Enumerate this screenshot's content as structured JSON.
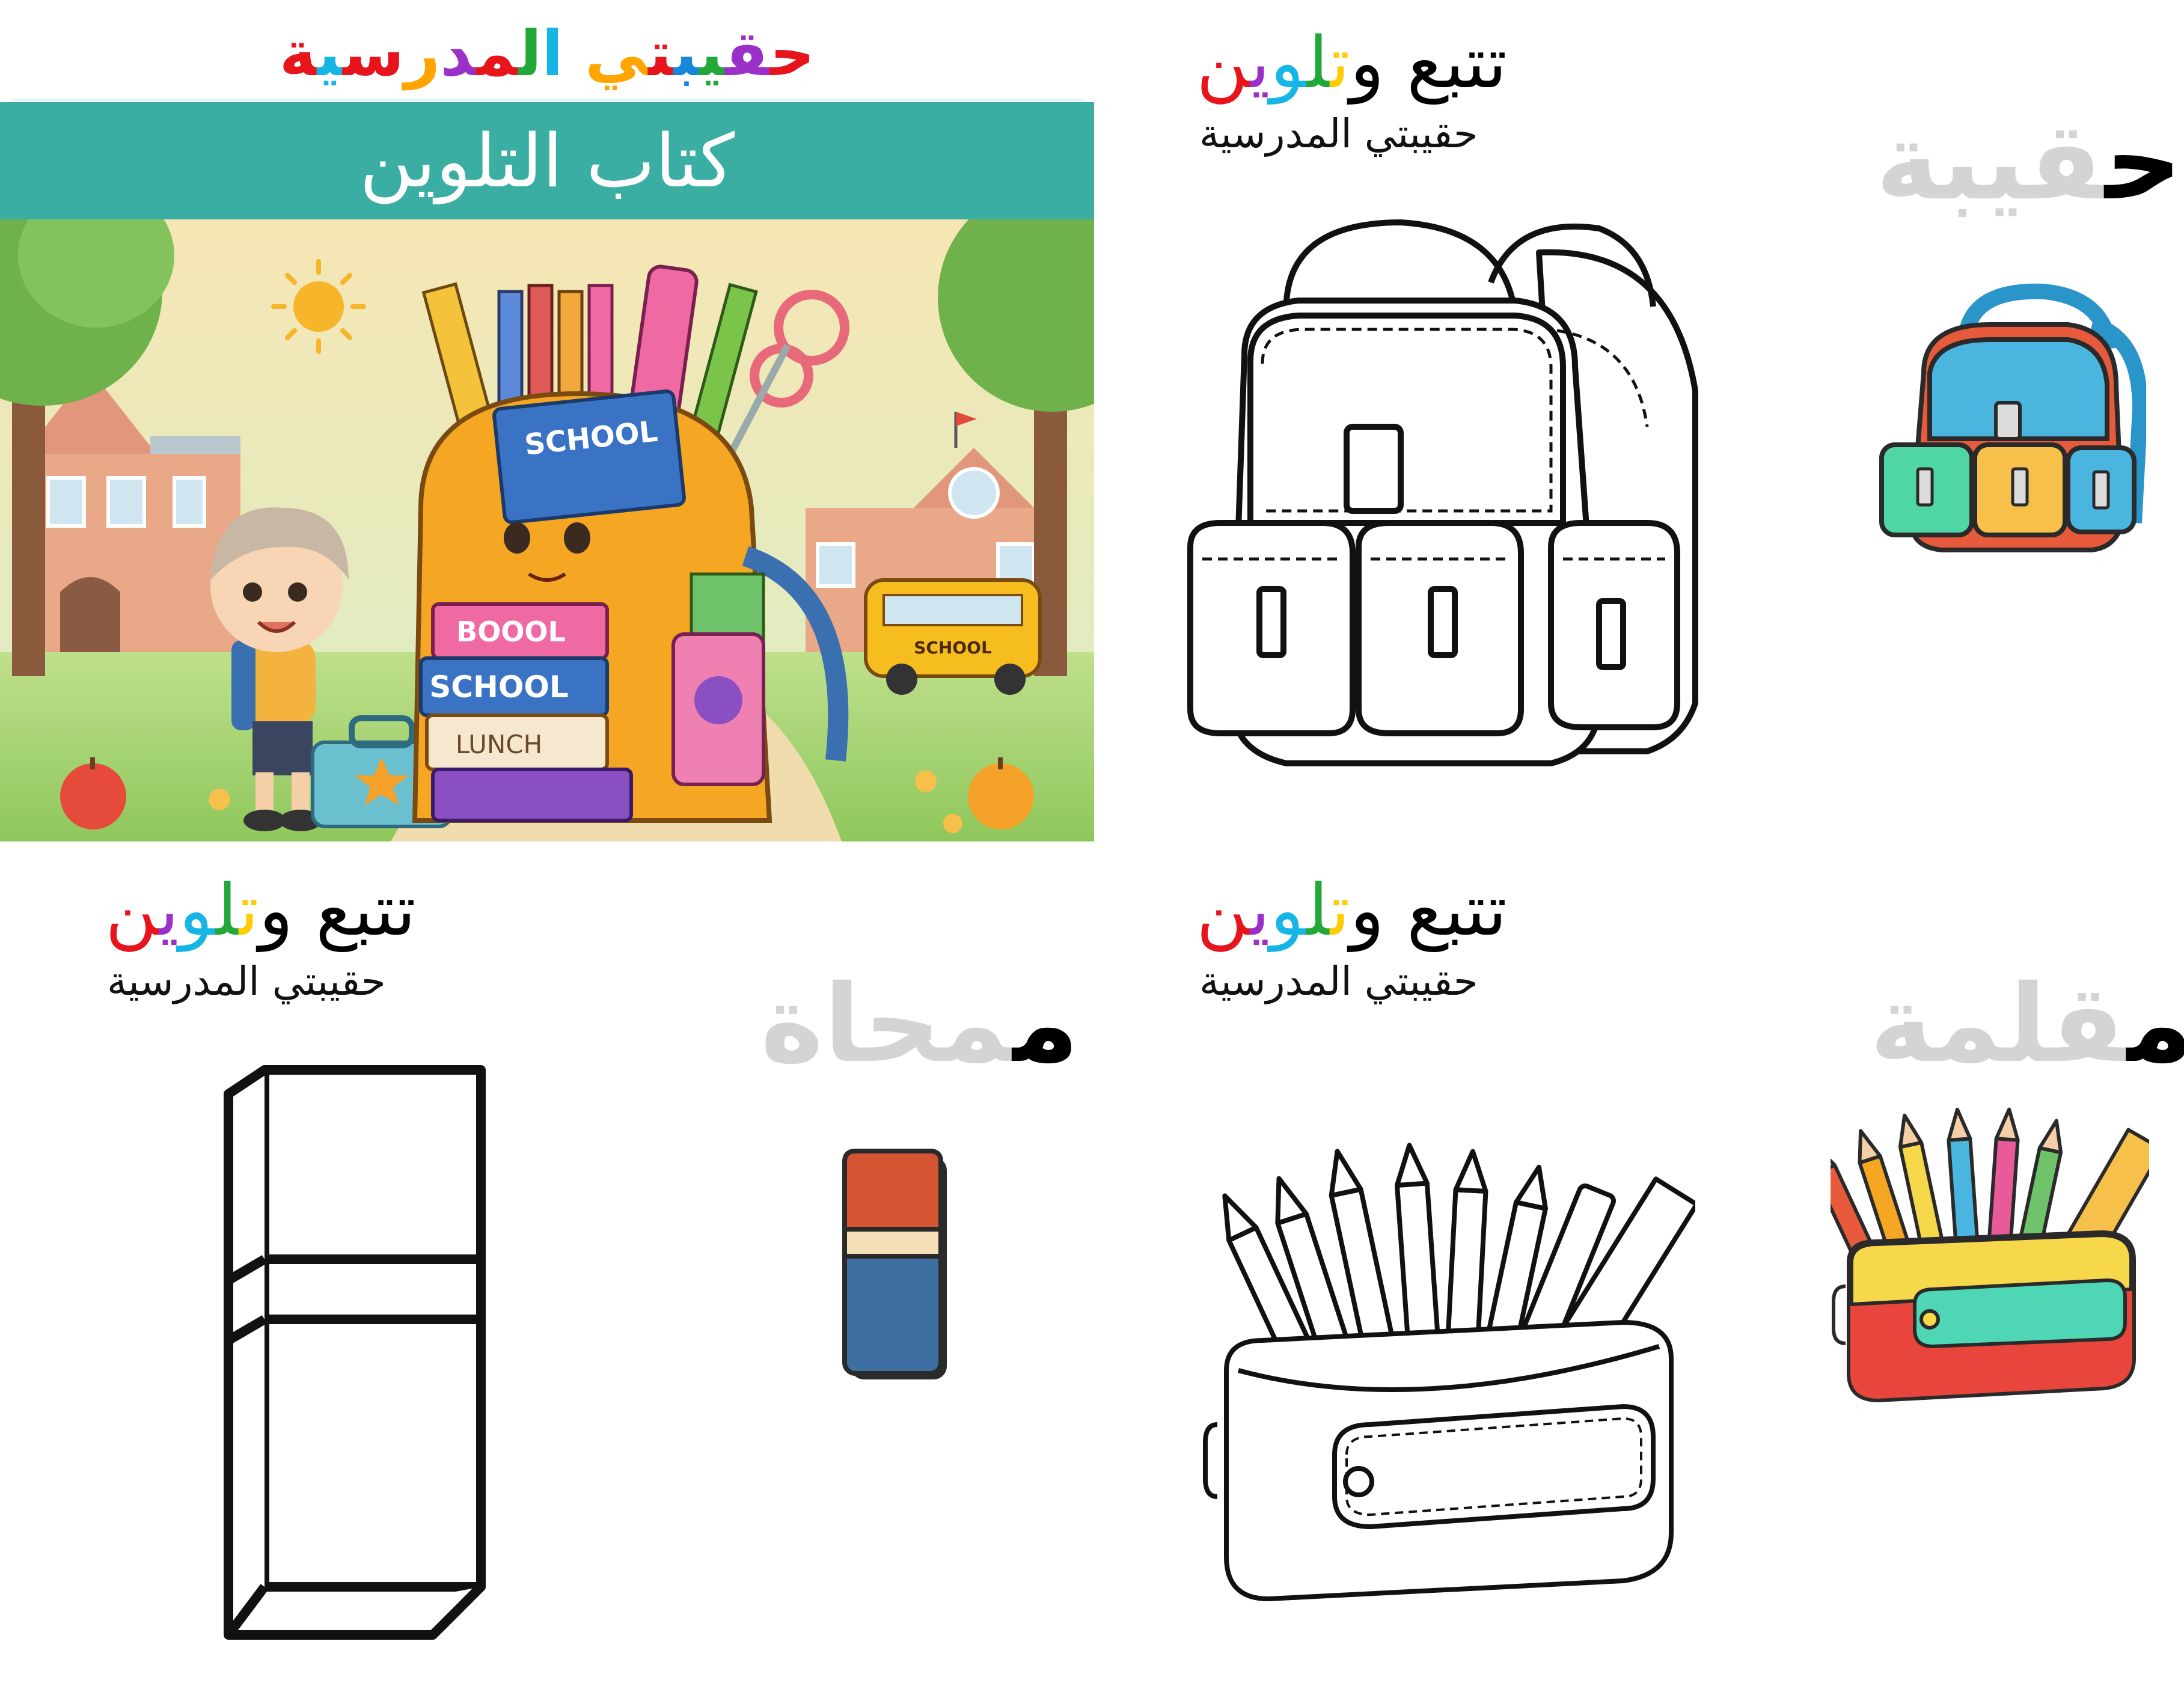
{
  "colors": {
    "teal_band": "#3baea3",
    "trace_gray": "#d4d4d4",
    "ink": "#000000"
  },
  "cover": {
    "title_letters": [
      {
        "char": "ح",
        "color": "#e8141c"
      },
      {
        "char": "ق",
        "color": "#9b30c9"
      },
      {
        "char": "ي",
        "color": "#22a839"
      },
      {
        "char": "ب",
        "color": "#1787d9"
      },
      {
        "char": "ت",
        "color": "#e8141c"
      },
      {
        "char": "ي",
        "color": "#ffa500"
      },
      {
        "char": " ",
        "color": "#000000"
      },
      {
        "char": "ا",
        "color": "#16b5e6"
      },
      {
        "char": "ل",
        "color": "#22a839"
      },
      {
        "char": "م",
        "color": "#e8141c"
      },
      {
        "char": "د",
        "color": "#9b30c9"
      },
      {
        "char": "ر",
        "color": "#ffa500"
      },
      {
        "char": "س",
        "color": "#e8141c"
      },
      {
        "char": "ي",
        "color": "#16b5e6"
      },
      {
        "char": "ة",
        "color": "#e8141c"
      }
    ],
    "subtitle": "كتاب التلوين",
    "illustration_text": {
      "book_top": "SCHOOL",
      "book_1": "BOOOL",
      "book_2": "SCHOOL",
      "book_3": "LUNCH",
      "bus": "SCHOOL"
    }
  },
  "worksheets": [
    {
      "id": "bag",
      "heading_parts": [
        {
          "text": "تتبع",
          "color": "#000000"
        },
        {
          "text": " و",
          "color": "#000000"
        },
        {
          "text": "ت",
          "color": "#ffcc00"
        },
        {
          "text": "ل",
          "color": "#22a839"
        },
        {
          "text": "و",
          "color": "#16b5e6"
        },
        {
          "text": "ي",
          "color": "#9b30c9"
        },
        {
          "text": "ن",
          "color": "#e8141c"
        }
      ],
      "subheading": "حقيبتي المدرسية",
      "word_first": "ح",
      "word_rest": "قيبة",
      "icon": "backpack"
    },
    {
      "id": "eraser",
      "heading_parts": [
        {
          "text": "تتبع",
          "color": "#000000"
        },
        {
          "text": " و",
          "color": "#000000"
        },
        {
          "text": "ت",
          "color": "#ffcc00"
        },
        {
          "text": "ل",
          "color": "#22a839"
        },
        {
          "text": "و",
          "color": "#16b5e6"
        },
        {
          "text": "ي",
          "color": "#9b30c9"
        },
        {
          "text": "ن",
          "color": "#e8141c"
        }
      ],
      "subheading": "حقيبتي المدرسية",
      "word_first": "م",
      "word_rest": "محاة",
      "icon": "eraser"
    },
    {
      "id": "pencil-case",
      "heading_parts": [
        {
          "text": "تتبع",
          "color": "#000000"
        },
        {
          "text": " و",
          "color": "#000000"
        },
        {
          "text": "ت",
          "color": "#ffcc00"
        },
        {
          "text": "ل",
          "color": "#22a839"
        },
        {
          "text": "و",
          "color": "#16b5e6"
        },
        {
          "text": "ي",
          "color": "#9b30c9"
        },
        {
          "text": "ن",
          "color": "#e8141c"
        }
      ],
      "subheading": "حقيبتي المدرسية",
      "word_first": "م",
      "word_rest": "قلمة",
      "icon": "pencil-case"
    }
  ]
}
